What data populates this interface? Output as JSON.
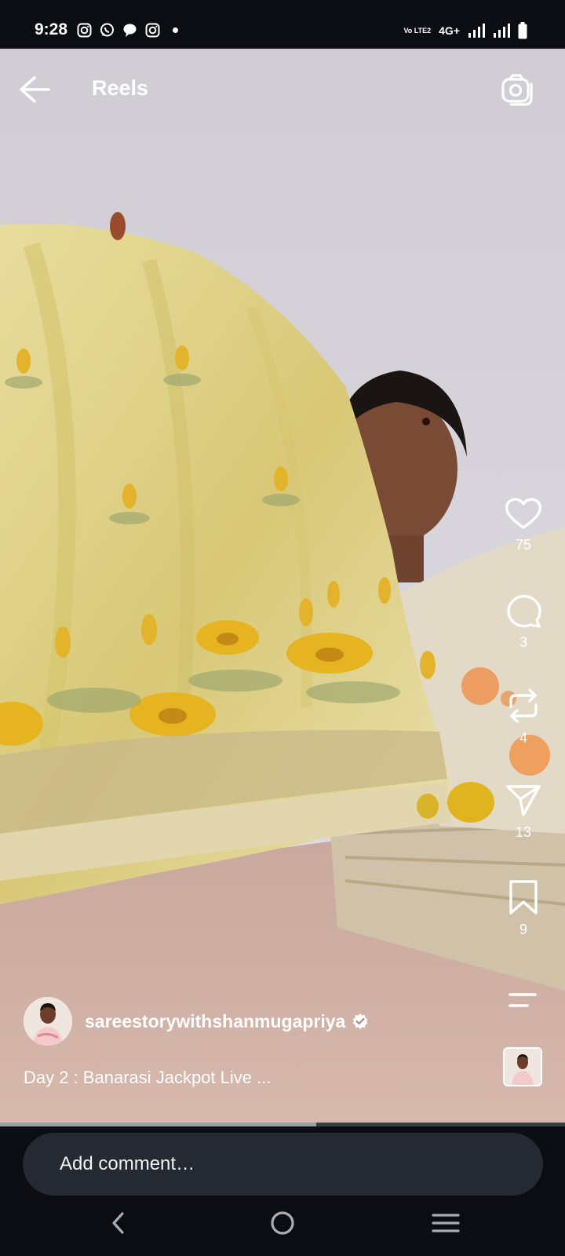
{
  "status_bar": {
    "time": "9:28",
    "notification_icons": [
      "instagram-icon",
      "whatsapp-icon",
      "chat-bubble-icon",
      "instagram-icon",
      "dot-icon"
    ],
    "volte_label": "Vo LTE2",
    "network": "4G+",
    "battery_icon": "battery-icon"
  },
  "header": {
    "title": "Reels",
    "back_icon": "arrow-left-icon",
    "camera_icon": "camera-icon"
  },
  "actions": {
    "likes": "75",
    "comments": "3",
    "reposts": "4",
    "shares": "13",
    "saves": "9"
  },
  "post": {
    "username": "sareestorywithshanmugapriya",
    "verified": true,
    "caption": "Day 2 : Banarasi Jackpot Live ..."
  },
  "video_progress": 0.56,
  "comment": {
    "placeholder": "Add comment…"
  },
  "colors": {
    "background": "#0b0d12",
    "comment_box": "#252931",
    "verified_badge": "#ffffff"
  }
}
